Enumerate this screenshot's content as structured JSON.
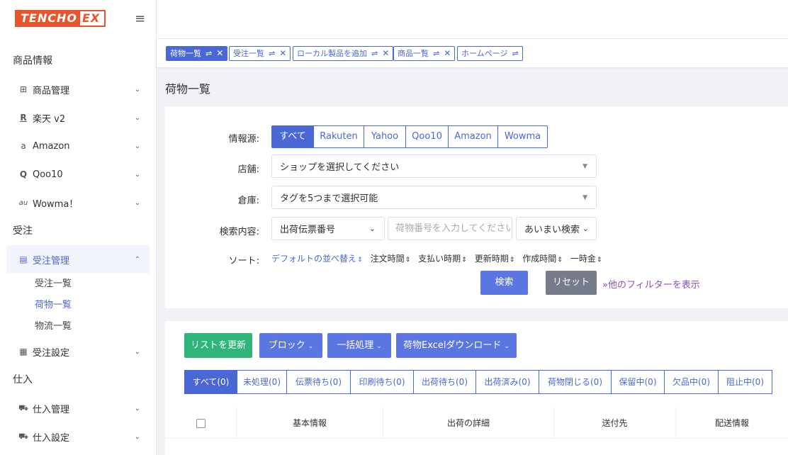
{
  "brand": {
    "logo_part1": "TENCHO",
    "logo_part2": "EX"
  },
  "sidebar": {
    "sections": [
      "商品情報",
      "受注",
      "仕入"
    ],
    "product_items": [
      {
        "label": "商品管理",
        "icon": "shop-icon",
        "glyph": "⊞"
      },
      {
        "label": "楽天 v2",
        "icon": "rakuten-icon",
        "glyph": "R"
      },
      {
        "label": "Amazon",
        "icon": "amazon-icon",
        "glyph": "a"
      },
      {
        "label": "Qoo10",
        "icon": "qoo10-icon",
        "glyph": "Q"
      },
      {
        "label": "Wowma！",
        "icon": "au-icon",
        "glyph": "au"
      }
    ],
    "order_management": {
      "label": "受注管理",
      "icon": "clipboard-icon",
      "glyph": "▤"
    },
    "order_subitems": [
      "受注一覧",
      "荷物一覧",
      "物流一覧"
    ],
    "order_settings": {
      "label": "受注設定",
      "icon": "settings-doc-icon",
      "glyph": "▦"
    },
    "purchase_items": [
      {
        "label": "仕入管理",
        "icon": "cart-icon",
        "glyph": "🛒"
      },
      {
        "label": "仕入設定",
        "icon": "cart-settings-icon",
        "glyph": "🛒"
      }
    ]
  },
  "tabs": [
    {
      "label": "荷物一覧",
      "closable": true,
      "active": true
    },
    {
      "label": "受注一覧",
      "closable": true,
      "active": false
    },
    {
      "label": "ローカル製品を追加",
      "closable": true,
      "active": false
    },
    {
      "label": "商品一覧",
      "closable": true,
      "active": false
    },
    {
      "label": "ホームページ",
      "closable": false,
      "active": false
    }
  ],
  "page": {
    "title": "荷物一覧"
  },
  "filters": {
    "source_label": "情報源:",
    "sources": [
      "すべて",
      "Rakuten",
      "Yahoo",
      "Qoo10",
      "Amazon",
      "Wowma"
    ],
    "shop_label": "店舗:",
    "shop_placeholder": "ショップを選択してください",
    "warehouse_label": "倉庫:",
    "warehouse_placeholder": "タグを5つまで選択可能",
    "search_label": "検索内容:",
    "search_field": "出荷伝票番号",
    "search_placeholder": "荷物番号を入力してください",
    "search_mode": "あいまい検索",
    "sort_label": "ソート:",
    "sort_options": [
      "デフォルトの並べ替え",
      "注文時間",
      "支払い時期",
      "更新時期",
      "作成時間",
      "一時金"
    ],
    "search_button": "検索",
    "reset_button": "リセット",
    "more_filters": "他のフィルターを表示"
  },
  "actions": {
    "refresh": "リストを更新",
    "block": "ブロック",
    "batch": "一括処理",
    "excel": "荷物Excelダウンロード"
  },
  "status_tabs": [
    "すべて(0)",
    "未処理(0)",
    "伝票待ち(0)",
    "印刷待ち(0)",
    "出荷待ち(0)",
    "出荷済み(0)",
    "荷物閉じる(0)",
    "保留中(0)",
    "欠品中(0)",
    "阻止中(0)"
  ],
  "table": {
    "columns": [
      "基本情報",
      "出荷の詳細",
      "送付先",
      "配送情報"
    ]
  },
  "colors": {
    "primary": "#4a67d6",
    "success": "#2fb57a",
    "reset": "#767c8c",
    "brand": "#e8552a",
    "more": "#8d4fb8"
  }
}
